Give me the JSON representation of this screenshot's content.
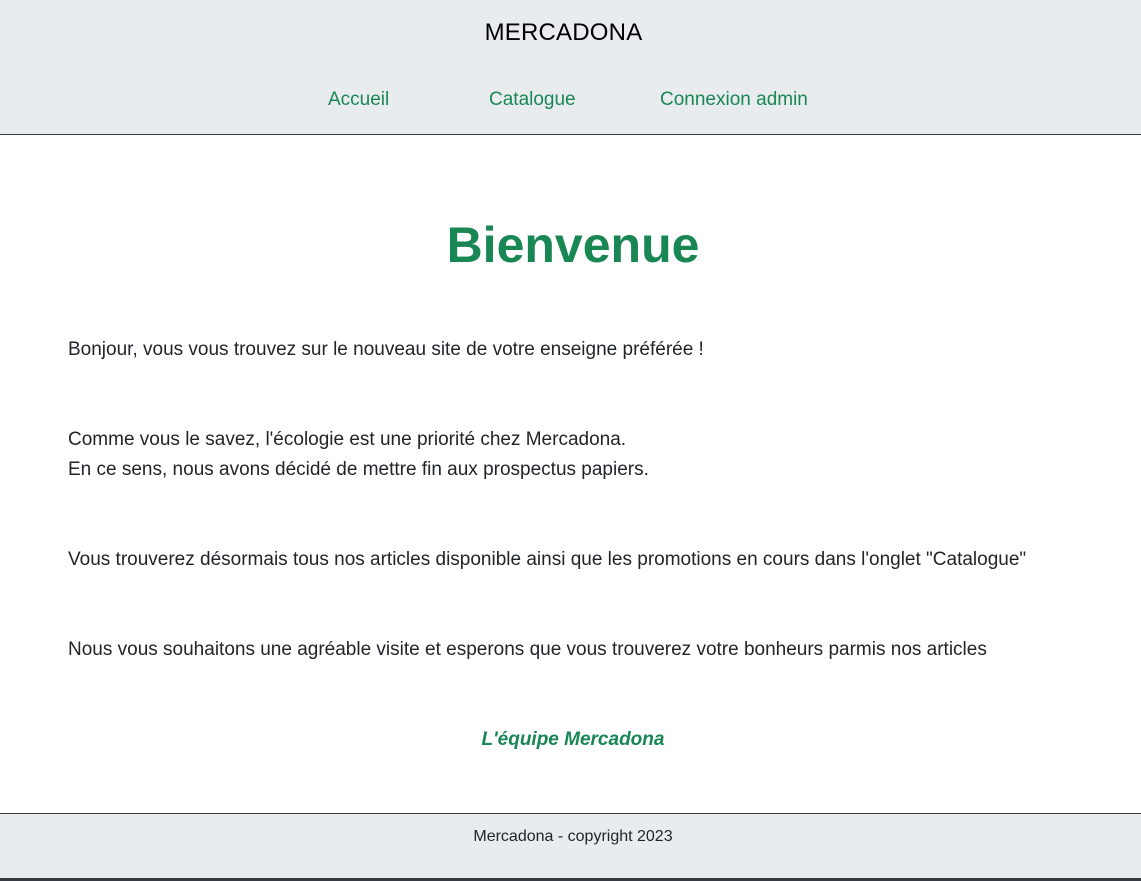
{
  "header": {
    "brand": "MERCADONA",
    "nav": {
      "home": "Accueil",
      "catalogue": "Catalogue",
      "admin_login": "Connexion admin"
    }
  },
  "main": {
    "title": "Bienvenue",
    "paragraphs": {
      "intro": "Bonjour, vous vous trouvez sur le nouveau site de votre enseigne préférée !",
      "ecology_line1": "Comme vous le savez, l'écologie est une priorité chez Mercadona.",
      "ecology_line2": "En ce sens, nous avons décidé de mettre fin aux prospectus papiers.",
      "catalogue_info": "Vous trouverez désormais tous nos articles disponible ainsi que les promotions en cours dans l'onglet \"Catalogue\"",
      "closing": "Nous vous souhaitons une agréable visite et esperons que vous trouverez votre bonheurs parmis nos articles"
    },
    "signature": "L'équipe Mercadona"
  },
  "footer": {
    "copyright": "Mercadona - copyright 2023"
  },
  "colors": {
    "accent": "#198754",
    "bar_background": "#e9ecef",
    "border": "#343a40",
    "text": "#212529"
  }
}
